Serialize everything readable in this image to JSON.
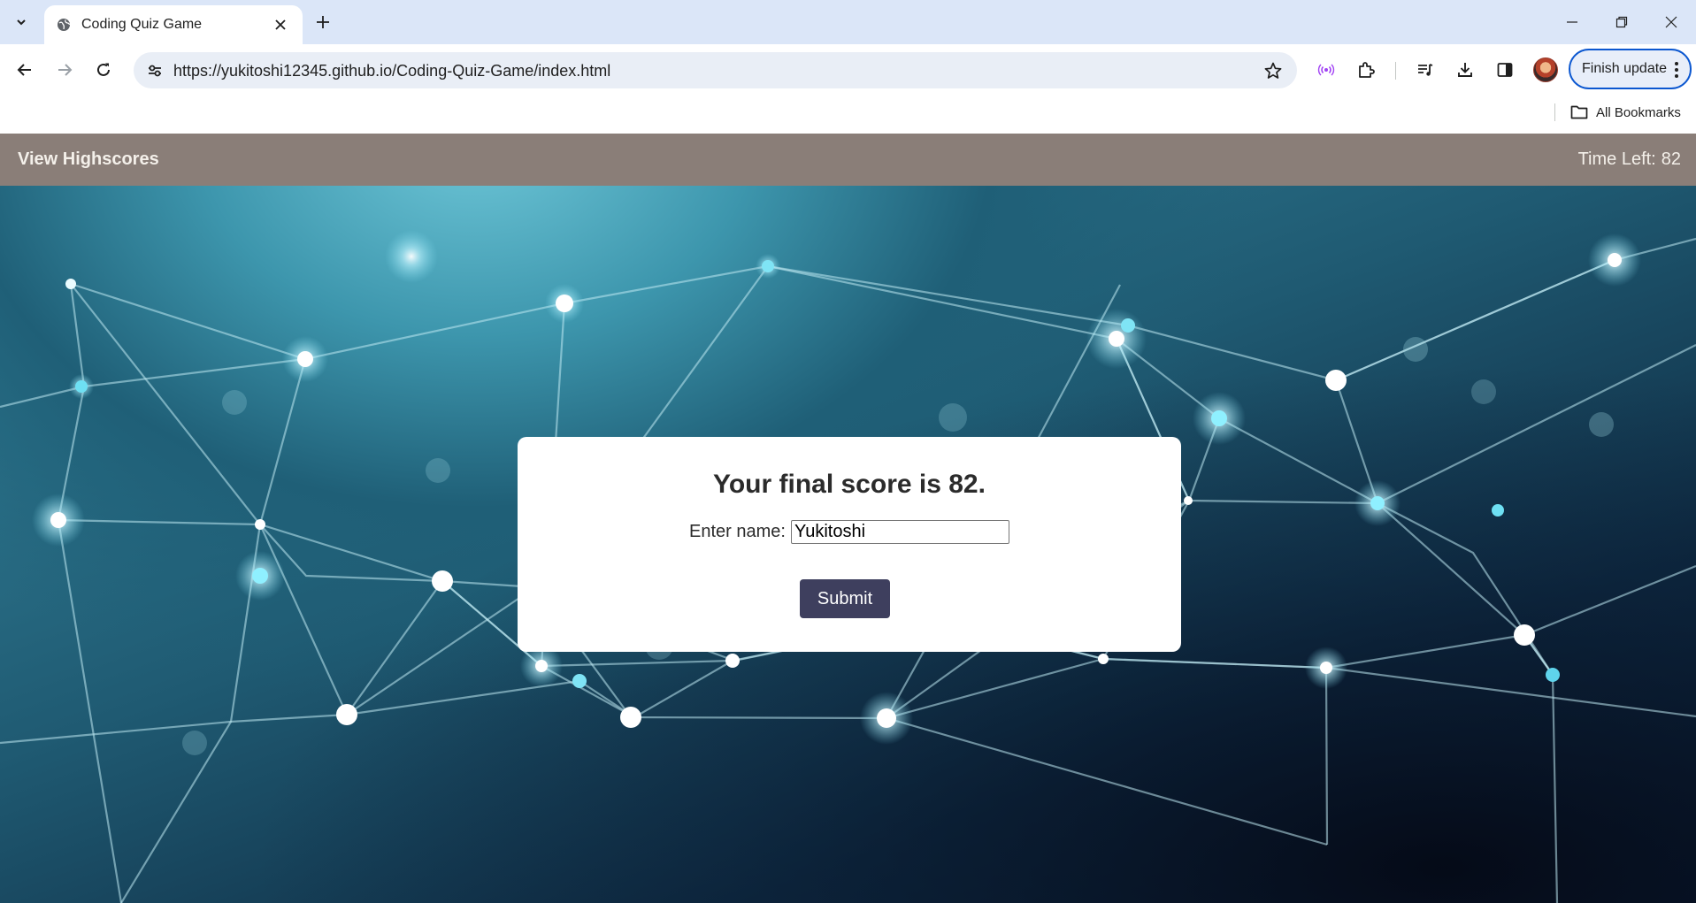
{
  "browser": {
    "tab": {
      "title": "Coding Quiz Game"
    },
    "url": "https://yukitoshi12345.github.io/Coding-Quiz-Game/index.html",
    "finish_update_label": "Finish update",
    "all_bookmarks_label": "All Bookmarks",
    "icons": {
      "tab_search": "chevron-down-icon",
      "favicon": "globe-icon",
      "tab_close": "close-icon",
      "new_tab": "plus-icon",
      "back": "arrow-left-icon",
      "forward": "arrow-right-icon",
      "reload": "reload-icon",
      "site_info": "tune-icon",
      "bookmark": "star-icon",
      "media": "broadcast-icon",
      "extensions": "puzzle-icon",
      "reading_list": "playlist-icon",
      "downloads": "download-icon",
      "side_panel": "side-panel-icon",
      "menu": "kebab-icon",
      "folder": "folder-icon"
    }
  },
  "page": {
    "header": {
      "view_highscores": "View Highscores",
      "timer_label": "Time Left:",
      "timer_value": "82"
    },
    "card": {
      "final_score_text": "Your final score is 82.",
      "name_label": "Enter name:",
      "name_value": "Yukitoshi",
      "submit_label": "Submit"
    },
    "colors": {
      "header_bg": "#8a7e78",
      "submit_bg": "#3e3f5e",
      "accent_blue": "#0b57d0"
    }
  }
}
